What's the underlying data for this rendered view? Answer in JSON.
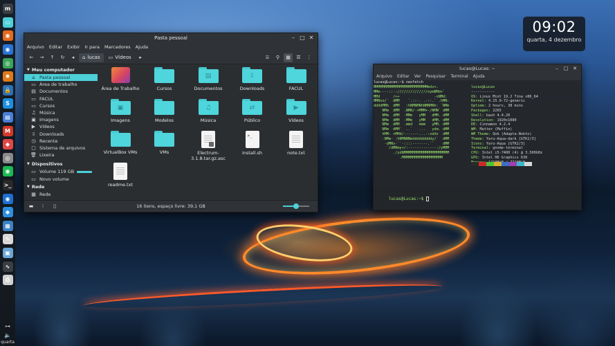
{
  "desktop": {
    "clock": {
      "time": "09:02",
      "date": "quarta, 4 dezembro"
    }
  },
  "dock": {
    "icons": [
      {
        "name": "menu-icon",
        "glyph": "m",
        "color": "#3a3f44"
      },
      {
        "name": "files-icon",
        "glyph": "▭",
        "color": "#4dd0d8"
      },
      {
        "name": "firefox-icon",
        "glyph": "◉",
        "color": "#e66a1d"
      },
      {
        "name": "thunderbird-icon",
        "glyph": "◉",
        "color": "#2a74d6"
      },
      {
        "name": "chrome-icon",
        "glyph": "◎",
        "color": "#3aa55a"
      },
      {
        "name": "settings-gear-icon",
        "glyph": "✹",
        "color": "#e07a18"
      },
      {
        "name": "lock-icon",
        "glyph": "🔒",
        "color": "#2e6fb8"
      },
      {
        "name": "skype-icon",
        "glyph": "S",
        "color": "#1d8fe0"
      },
      {
        "name": "docs-icon",
        "glyph": "▤",
        "color": "#4a7fd8"
      },
      {
        "name": "gmail-icon",
        "glyph": "M",
        "color": "#d23a2b"
      },
      {
        "name": "app-icon",
        "glyph": "◆",
        "color": "#e04848"
      },
      {
        "name": "disk-icon",
        "glyph": "◎",
        "color": "#8a8a8a"
      },
      {
        "name": "spotify-icon",
        "glyph": "◉",
        "color": "#1db954"
      },
      {
        "name": "terminal-icon",
        "glyph": ">_",
        "color": "#2a2a2a"
      },
      {
        "name": "browser-icon",
        "glyph": "◉",
        "color": "#1e6fd0"
      },
      {
        "name": "vscode-icon",
        "glyph": "◆",
        "color": "#2d8fe0"
      },
      {
        "name": "monitor-icon",
        "glyph": "▦",
        "color": "#3b82c4"
      },
      {
        "name": "editor-icon",
        "glyph": "✎",
        "color": "#d8d8d8"
      },
      {
        "name": "photo-icon",
        "glyph": "▣",
        "color": "#6aa6d8"
      },
      {
        "name": "system-monitor-icon",
        "glyph": "∿",
        "color": "#3a3f44"
      },
      {
        "name": "printer-icon",
        "glyph": "⎙",
        "color": "#cfcfcf"
      }
    ],
    "bottom": {
      "clock_label": "quarta"
    }
  },
  "file_manager": {
    "title": "Pasta pessoal",
    "menu": [
      "Arquivo",
      "Editar",
      "Exibir",
      "Ir para",
      "Marcadores",
      "Ajuda"
    ],
    "breadcrumb": [
      "lucas",
      "Vídeos"
    ],
    "sidebar": {
      "sections": [
        {
          "heading": "Meu computador",
          "items": [
            {
              "label": "Pasta pessoal",
              "icon": "home-icon",
              "glyph": "⌂",
              "selected": true
            },
            {
              "label": "Área de trabalho",
              "icon": "desktop-icon",
              "glyph": "▭"
            },
            {
              "label": "Documentos",
              "icon": "documents-icon",
              "glyph": "▤"
            },
            {
              "label": "FACUL",
              "icon": "folder-icon",
              "glyph": "▭"
            },
            {
              "label": "Cursos",
              "icon": "folder-icon",
              "glyph": "▭"
            },
            {
              "label": "Música",
              "icon": "music-icon",
              "glyph": "♫"
            },
            {
              "label": "Imagens",
              "icon": "pictures-icon",
              "glyph": "▣"
            },
            {
              "label": "Vídeos",
              "icon": "videos-icon",
              "glyph": "▶"
            },
            {
              "label": "Downloads",
              "icon": "downloads-icon",
              "glyph": "⇩"
            },
            {
              "label": "Recente",
              "icon": "recent-icon",
              "glyph": "◷"
            },
            {
              "label": "Sistema de arquivos",
              "icon": "filesystem-icon",
              "glyph": "▢"
            },
            {
              "label": "Lixeira",
              "icon": "trash-icon",
              "glyph": "🗑"
            }
          ]
        },
        {
          "heading": "Dispositivos",
          "items": [
            {
              "label": "Volume 119 GB",
              "icon": "drive-icon",
              "glyph": "▭",
              "bar": 0.55
            },
            {
              "label": "Novo volume",
              "icon": "drive-icon",
              "glyph": "▭"
            }
          ]
        },
        {
          "heading": "Rede",
          "items": [
            {
              "label": "Rede",
              "icon": "network-icon",
              "glyph": "▦"
            }
          ]
        }
      ]
    },
    "items": [
      {
        "label": "Área de Trabalho",
        "kind": "desktop"
      },
      {
        "label": "Cursos",
        "kind": "folder"
      },
      {
        "label": "Documentos",
        "kind": "folder",
        "glyph": "▤"
      },
      {
        "label": "Downloads",
        "kind": "folder",
        "glyph": "⇩"
      },
      {
        "label": "FACUL",
        "kind": "folder"
      },
      {
        "label": "Imagens",
        "kind": "folder",
        "glyph": "▣"
      },
      {
        "label": "Modelos",
        "kind": "folder"
      },
      {
        "label": "Música",
        "kind": "folder",
        "glyph": "♫"
      },
      {
        "label": "Público",
        "kind": "folder",
        "glyph": "⇄"
      },
      {
        "label": "Vídeos",
        "kind": "folder",
        "glyph": "▶"
      },
      {
        "label": "VirtualBox VMs",
        "kind": "folder"
      },
      {
        "label": "VMs",
        "kind": "folder"
      },
      {
        "label": "Electrum-3.1.8.tar.gz.asc",
        "kind": "file"
      },
      {
        "label": "install.sh",
        "kind": "script"
      },
      {
        "label": "note.txt",
        "kind": "file"
      },
      {
        "label": "readme.txt",
        "kind": "file"
      }
    ],
    "status": "16 itens, espaço livre: 39,1 GB",
    "zoom_level": 0.5
  },
  "terminal": {
    "title": "lucas@Lucas: ~",
    "menu": [
      "Arquivo",
      "Editar",
      "Ver",
      "Pesquisar",
      "Terminal",
      "Ajuda"
    ],
    "command_prompt": "lucas@Lucas:~$ neofetch",
    "ascii": [
      "MMMMMMMMMMMMMMMMMMMMMMMMMmds+.",
      "MMm----::-://////////////oymNMd+`",
      "MMd      /++                -sNMd:",
      "MMNso/`  dMM    `.::-. .-::.` .hMN:",
      "ddddMMh  dMM   :hNMNMNhNMNMNh: `NMm",
      "    NMm  dMM  .NMN/-+MMM+-/NMN` dMM",
      "    NMm  dMM  -MMm   yMM   dMM. dMM",
      "    NMm  dMM  -MMm   yMM   dMM. dMM",
      "    NMm  dMM  .mmd   mmm   yMM. dMM",
      "    NMm  dMM`  ..`   ...   ydm. dMM",
      "    hMM- +MMd/-------...-:sdds  dMM",
      "    -NMm- :hNMNNNmdddddddddy/`  dMM",
      "     -dMNs-``-::::-------.``    dMM",
      "      `/dMNmy+/:-------------:/yMMM",
      "         ./ydNMMMMMMMMMMMMMMMMMMMMM",
      "            .MMMMMMMMMMMMMMMMMMM"
    ],
    "info_header": "lucas@Lucas",
    "info_rule": "-----------",
    "info": [
      {
        "key": "OS",
        "value": "Linux Mint 19.2 Tina x86_64"
      },
      {
        "key": "Kernel",
        "value": "4.15.0-72-generic"
      },
      {
        "key": "Uptime",
        "value": "2 hours, 38 mins"
      },
      {
        "key": "Packages",
        "value": "2265"
      },
      {
        "key": "Shell",
        "value": "bash 4.4.20"
      },
      {
        "key": "Resolution",
        "value": "1920x1080"
      },
      {
        "key": "DE",
        "value": "Cinnamon 4.2.4"
      },
      {
        "key": "WM",
        "value": "Mutter (Muffin)"
      },
      {
        "key": "WM Theme",
        "value": "Qob (Adapta-Nokto)"
      },
      {
        "key": "Theme",
        "value": "Yaru-Aqua-dark [GTK2/3]"
      },
      {
        "key": "Icons",
        "value": "Yaru-Aqua [GTK2/3]"
      },
      {
        "key": "Terminal",
        "value": "gnome-terminal"
      },
      {
        "key": "CPU",
        "value": "Intel i5-7400 (4) @ 3.500GHz"
      },
      {
        "key": "GPU",
        "value": "Intel HD Graphics 630"
      },
      {
        "key": "Memory",
        "value": "1719MiB / 7720MiB"
      }
    ],
    "swatches": [
      "#2b2b2b",
      "#cc2a2a",
      "#4ec23a",
      "#d8b030",
      "#3a6ec8",
      "#a040b0",
      "#38b8c8",
      "#d8d8d8"
    ],
    "final_prompt": "lucas@Lucas:~$ "
  }
}
